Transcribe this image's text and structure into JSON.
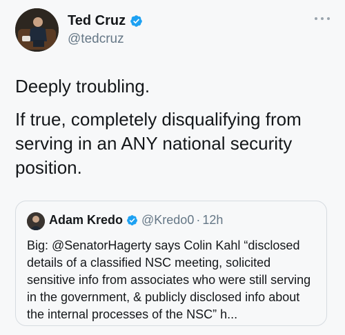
{
  "author": {
    "name": "Ted Cruz",
    "handle": "@tedcruz"
  },
  "tweet": {
    "paragraphs": [
      "Deeply troubling.",
      "If true, completely disqualifying from serving in an ANY national security position."
    ]
  },
  "quoted": {
    "name": "Adam Kredo",
    "handle": "@Kredo0",
    "separator": "·",
    "time": "12h",
    "text": "Big: @SenatorHagerty says Colin Kahl “disclosed details of a classified NSC meeting, solicited sensitive info from associates who were still serving in the government, & publicly disclosed info about the internal processes of the NSC” h..."
  },
  "colors": {
    "verified": "#1da1f2",
    "secondary_text": "#657786",
    "border": "#d6dbe0"
  },
  "icons": {
    "verified": "verified-badge-icon",
    "more": "more-options-icon"
  }
}
